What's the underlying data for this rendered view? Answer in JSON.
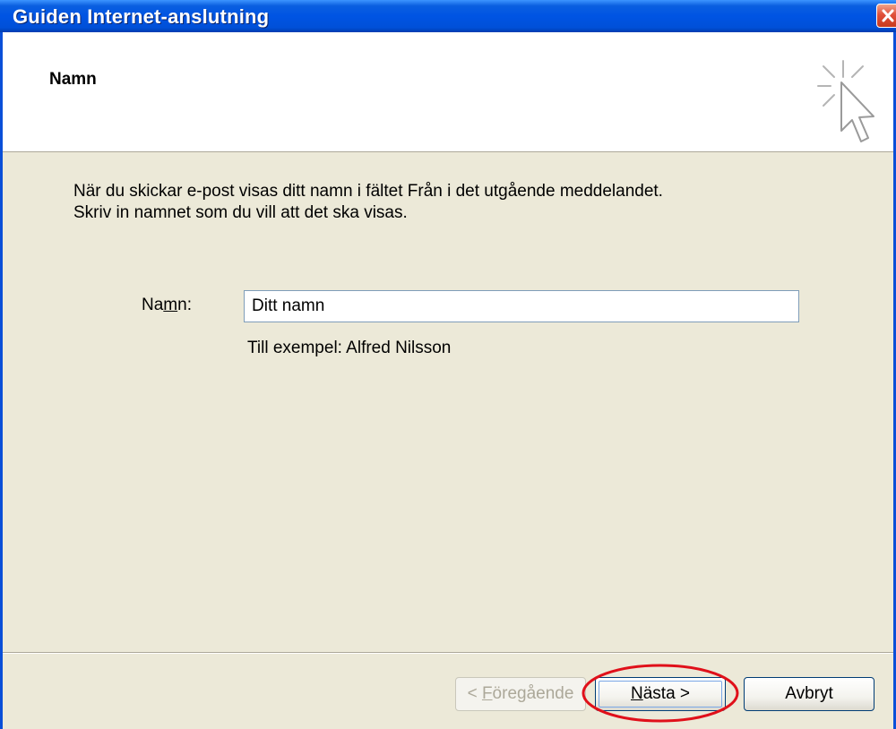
{
  "window": {
    "title": "Guiden Internet-anslutning"
  },
  "header": {
    "title": "Namn"
  },
  "body": {
    "description_line1": "När du skickar e-post visas ditt namn i fältet Från i det utgående meddelandet.",
    "description_line2": "Skriv in namnet som du vill att det ska visas.",
    "name_label_pre": "Na",
    "name_label_mnemonic": "m",
    "name_label_post": "n:",
    "name_value": "Ditt namn",
    "example": "Till exempel: Alfred Nilsson"
  },
  "buttons": {
    "prev_pre": "< ",
    "prev_mnemonic": "F",
    "prev_post": "öregående",
    "next_mnemonic": "N",
    "next_post": "ästa >",
    "cancel": "Avbryt"
  },
  "colors": {
    "titlebar": "#0054e3",
    "dialog_bg": "#ece9d8",
    "highlight": "#e0101a"
  },
  "icons": {
    "close": "close-icon",
    "wizard": "cursor-sparkle-icon"
  }
}
